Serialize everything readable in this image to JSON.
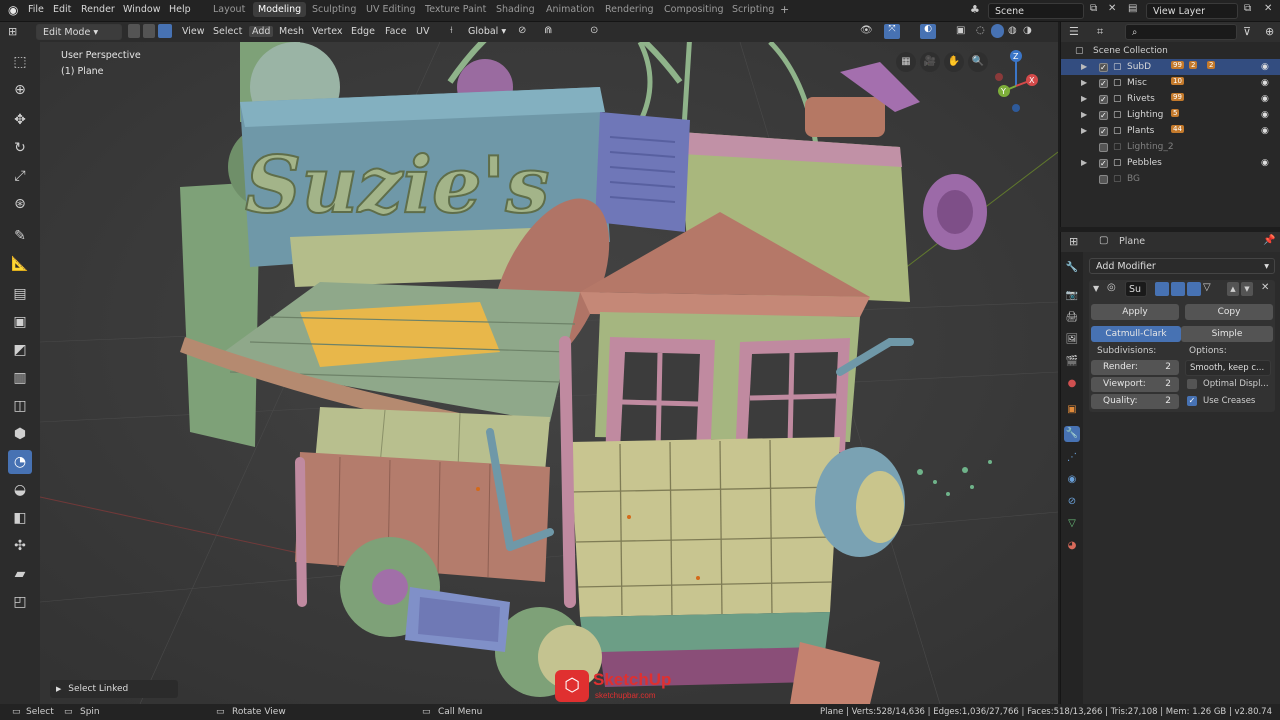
{
  "topbar": {
    "menus": [
      "File",
      "Edit",
      "Render",
      "Window",
      "Help"
    ],
    "workspaces": [
      "Layout",
      "Modeling",
      "Sculpting",
      "UV Editing",
      "Texture Paint",
      "Shading",
      "Animation",
      "Rendering",
      "Compositing",
      "Scripting"
    ],
    "active_workspace": "Modeling",
    "scene": "Scene",
    "view_layer": "View Layer"
  },
  "viewport_header": {
    "mode": "Edit Mode",
    "menus": [
      "View",
      "Select",
      "Add",
      "Mesh",
      "Vertex",
      "Edge",
      "Face",
      "UV"
    ],
    "orientation": "Global"
  },
  "viewport": {
    "perspective_label": "User Perspective",
    "object_label": "(1) Plane",
    "sign_text": "Suzie's",
    "last_op": "Select Linked",
    "watermark": "SketchUp",
    "watermark_url": "sketchupbar.com",
    "gizmo_axes": [
      "X",
      "Y",
      "Z"
    ]
  },
  "outliner": {
    "root": "Scene Collection",
    "items": [
      {
        "label": "SubD",
        "selected": true,
        "checked": true,
        "badges": [
          "99",
          "2",
          "2"
        ]
      },
      {
        "label": "Misc",
        "selected": false,
        "checked": true,
        "badges": [
          "10"
        ]
      },
      {
        "label": "Rivets",
        "selected": false,
        "checked": true,
        "badges": [
          "99"
        ]
      },
      {
        "label": "Lighting",
        "selected": false,
        "checked": true,
        "badges": [
          "5"
        ]
      },
      {
        "label": "Plants",
        "selected": false,
        "checked": true,
        "badges": [
          "44"
        ]
      },
      {
        "label": "Lighting_2",
        "selected": false,
        "checked": false,
        "badges": []
      },
      {
        "label": "Pebbles",
        "selected": false,
        "checked": true,
        "badges": []
      },
      {
        "label": "BG",
        "selected": false,
        "checked": false,
        "badges": []
      }
    ]
  },
  "properties": {
    "object_name": "Plane",
    "add_modifier": "Add Modifier",
    "modifier_name": "Su",
    "apply": "Apply",
    "copy": "Copy",
    "type_catmull": "Catmull-Clark",
    "type_simple": "Simple",
    "subdivisions_label": "Subdivisions:",
    "options_label": "Options:",
    "render_label": "Render:",
    "render_value": "2",
    "viewport_label": "Viewport:",
    "viewport_value": "2",
    "quality_label": "Quality:",
    "quality_value": "2",
    "uv_smooth": "Smooth, keep c...",
    "optimal_display": "Optimal Displ...",
    "use_creases": "Use Creases",
    "optimal_checked": false,
    "creases_checked": true
  },
  "statusbar": {
    "select": "Select",
    "spin": "Spin",
    "rotate_view": "Rotate View",
    "call_menu": "Call Menu",
    "stats": "Plane | Verts:528/14,636 | Edges:1,036/27,766 | Faces:518/13,266 | Tris:27,108 | Mem: 1.26 GB | v2.80.74"
  },
  "colors": {
    "accent": "#4772b3",
    "selected_row": "#334d80",
    "viewport_bg": "#3a3a3a"
  }
}
